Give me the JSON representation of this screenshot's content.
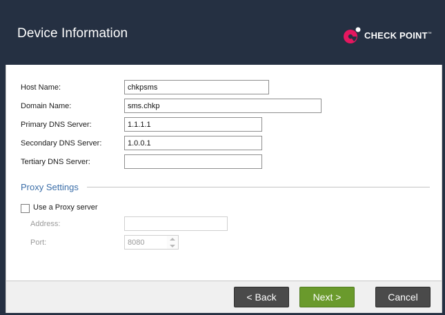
{
  "header": {
    "title": "Device Information",
    "logo_text": "CHECK POINT",
    "logo_tm": "™",
    "brand_pink": "#e5175f",
    "background": "#253042"
  },
  "form": {
    "host_name": {
      "label": "Host Name:",
      "value": "chkpsms"
    },
    "domain_name": {
      "label": "Domain Name:",
      "value": "sms.chkp"
    },
    "primary_dns": {
      "label": "Primary DNS Server:",
      "value": "1.1.1.1"
    },
    "secondary_dns": {
      "label": "Secondary DNS Server:",
      "value": "1.0.0.1"
    },
    "tertiary_dns": {
      "label": "Tertiary DNS Server:",
      "value": ""
    }
  },
  "proxy": {
    "section_title": "Proxy Settings",
    "use_proxy_label": "Use a Proxy server",
    "use_proxy_checked": false,
    "address": {
      "label": "Address:",
      "value": ""
    },
    "port": {
      "label": "Port:",
      "value": "8080"
    }
  },
  "footer": {
    "back_label": "< Back",
    "next_label": "Next >",
    "cancel_label": "Cancel",
    "next_color": "#6a9a2c"
  }
}
